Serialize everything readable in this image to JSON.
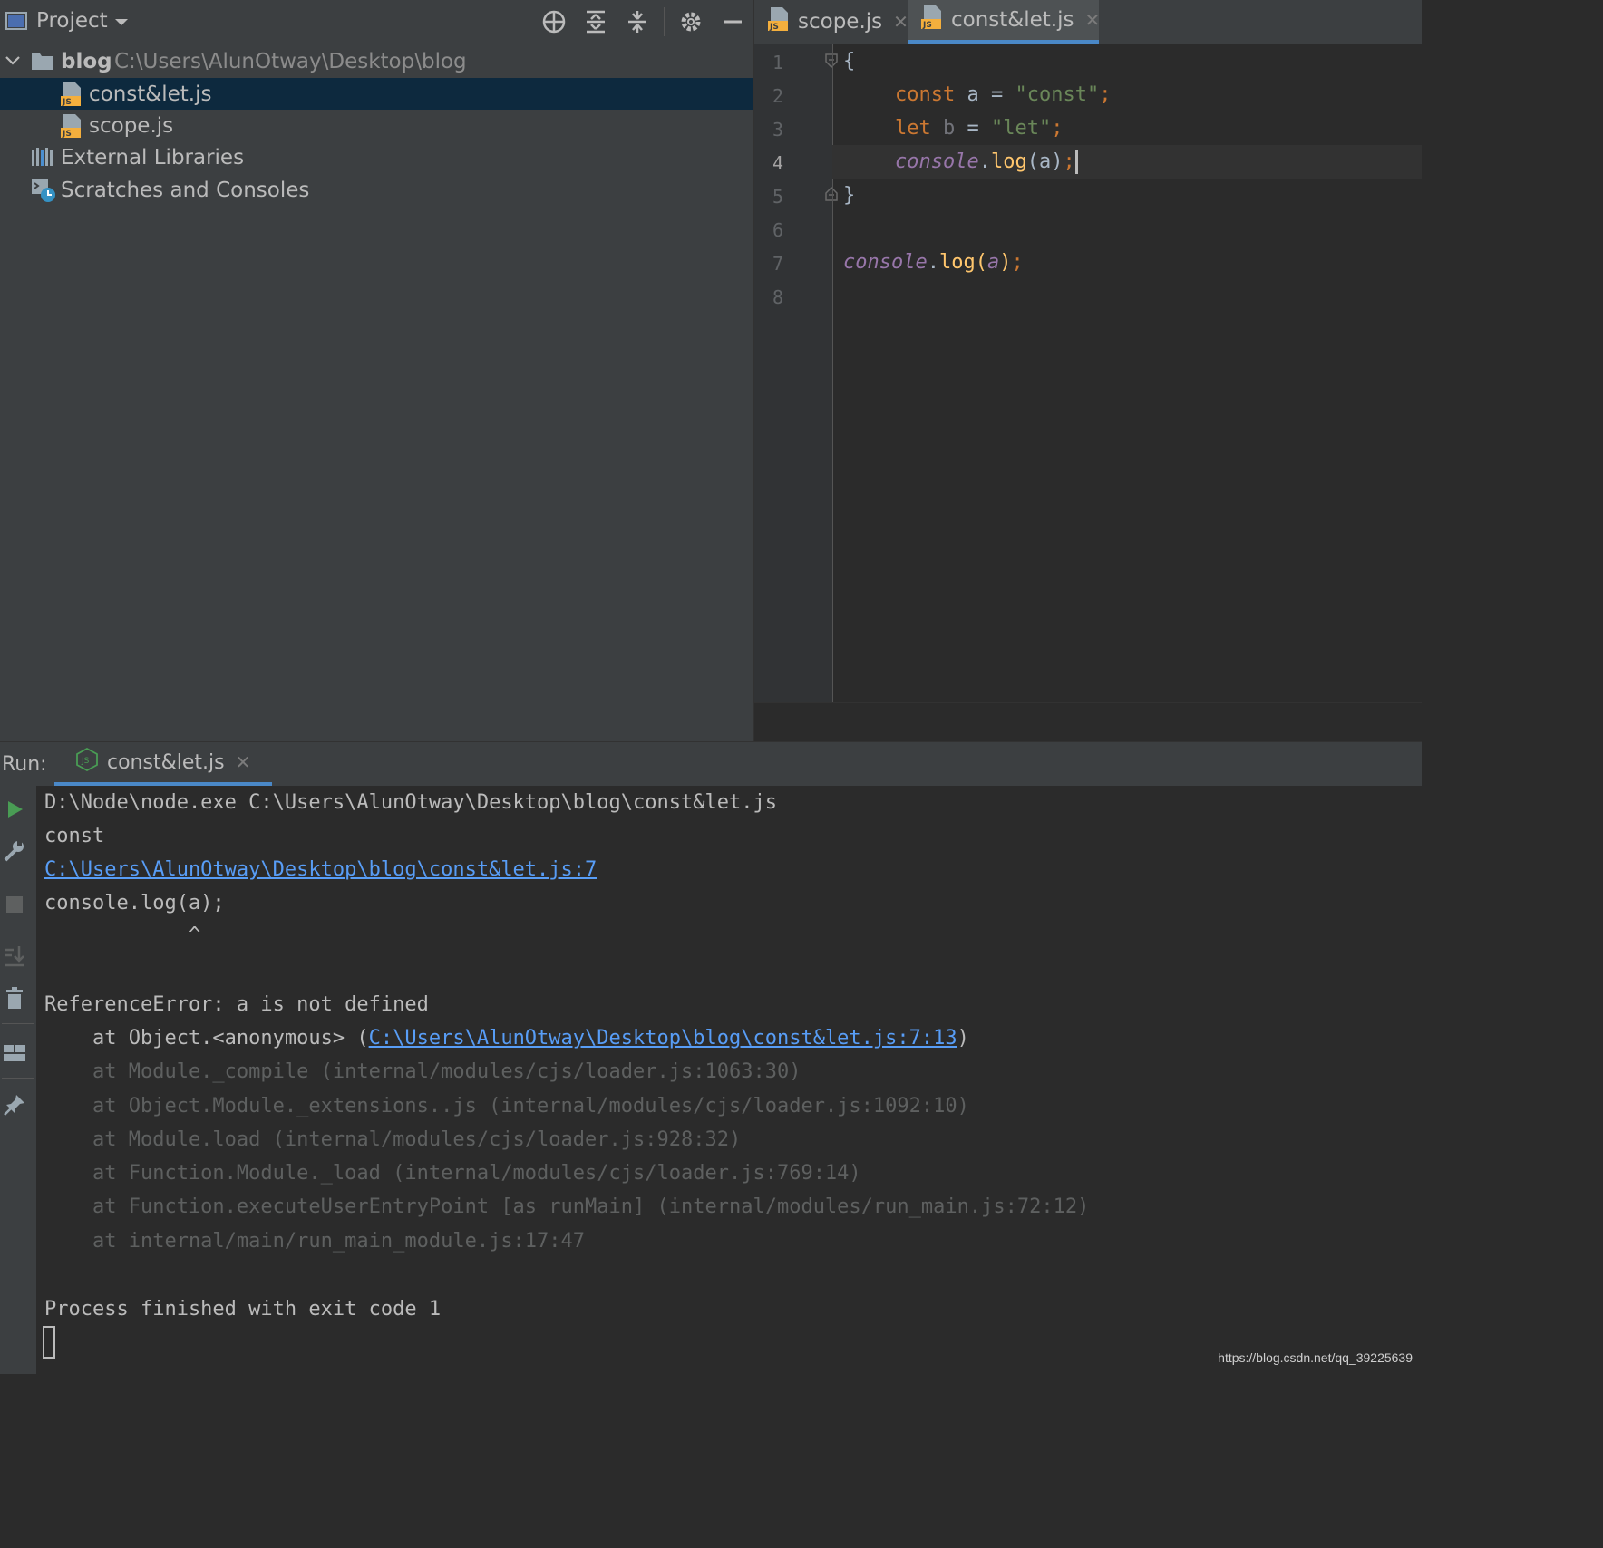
{
  "project_panel": {
    "title": "Project",
    "tree": {
      "root_name": "blog",
      "root_path": "C:\\Users\\AlunOtway\\Desktop\\blog",
      "file1": "const&let.js",
      "file2": "scope.js",
      "external_libraries": "External Libraries",
      "scratches": "Scratches and Consoles"
    }
  },
  "editor": {
    "tabs": [
      "scope.js",
      "const&let.js"
    ],
    "active_tab": "const&let.js",
    "line_numbers": [
      "1",
      "2",
      "3",
      "4",
      "5",
      "6",
      "7",
      "8"
    ],
    "code": {
      "l1_brace": "{",
      "l2_kw": "const",
      "l2_var": " a = ",
      "l2_str": "\"const\"",
      "l2_semi": ";",
      "l3_kw": "let",
      "l3_var": " b",
      "l3_eq": " = ",
      "l3_str": "\"let\"",
      "l3_semi": ";",
      "l4_obj": "console",
      "l4_dot": ".",
      "l4_fn": "log",
      "l4_args": "(a)",
      "l4_semi": ";",
      "l5_brace": "}",
      "l7_obj": "console",
      "l7_dot": ".",
      "l7_fn": "log",
      "l7_open": "(",
      "l7_arg": "a",
      "l7_close": ")",
      "l7_semi": ";"
    }
  },
  "run_panel": {
    "label": "Run:",
    "tab": "const&let.js",
    "console": {
      "cmd": "D:\\Node\\node.exe C:\\Users\\AlunOtway\\Desktop\\blog\\const&let.js",
      "out1": "const",
      "link1": "C:\\Users\\AlunOtway\\Desktop\\blog\\const&let.js:7",
      "src": "console.log(a);",
      "caret": "            ^",
      "error": "ReferenceError: a is not defined",
      "at1_prefix": "    at Object.<anonymous> (",
      "at1_link": "C:\\Users\\AlunOtway\\Desktop\\blog\\const&let.js:7:13",
      "at1_suffix": ")",
      "at2": "    at Module._compile (internal/modules/cjs/loader.js:1063:30)",
      "at3": "    at Object.Module._extensions..js (internal/modules/cjs/loader.js:1092:10)",
      "at4": "    at Module.load (internal/modules/cjs/loader.js:928:32)",
      "at5": "    at Function.Module._load (internal/modules/cjs/loader.js:769:14)",
      "at6": "    at Function.executeUserEntryPoint [as runMain] (internal/modules/run_main.js:72:12)",
      "at7": "    at internal/main/run_main_module.js:17:47",
      "exit": "Process finished with exit code 1"
    }
  },
  "watermark": "https://blog.csdn.net/qq_39225639",
  "colors": {
    "panel_bg": "#3c3f41",
    "editor_bg": "#2b2b2b",
    "selection": "#0d293e",
    "keyword": "#cc7832",
    "string": "#6a8759",
    "global": "#9876aa",
    "function": "#ffc66d",
    "link": "#589df6",
    "run_green": "#499c54"
  }
}
